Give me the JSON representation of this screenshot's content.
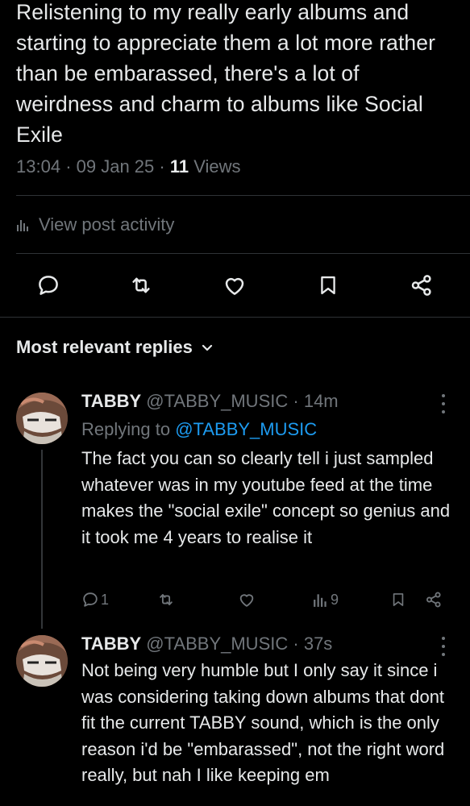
{
  "post": {
    "text": "Relistening to my really early albums and starting to appreciate them a lot more rather than be embarassed, there's a lot of weirdness and charm to albums like Social Exile",
    "time": "13:04",
    "date": "09 Jan 25",
    "views_count": "11",
    "views_label": "Views",
    "separator": "·"
  },
  "activity": {
    "label": "View post activity",
    "icon": "chart-bars-icon"
  },
  "actions": {
    "icons": [
      "reply-icon",
      "retweet-icon",
      "like-icon",
      "bookmark-icon",
      "share-icon"
    ]
  },
  "sort": {
    "label": "Most relevant replies"
  },
  "replies": [
    {
      "name": "TABBY",
      "handle": "@TABBY_MUSIC",
      "age": "14m",
      "replying_prefix": "Replying to",
      "replying_handle": "@TABBY_MUSIC",
      "text": "The fact you can so clearly tell i just sampled whatever was in my youtube feed at the time makes the \"social exile\" concept so genius and it took me 4 years to realise it",
      "reply_count": "1",
      "view_count": "9"
    },
    {
      "name": "TABBY",
      "handle": "@TABBY_MUSIC",
      "age": "37s",
      "text": "Not being very humble but I only say it since i was considering taking down albums that dont fit the current TABBY sound, which is the only reason i'd be \"embarassed\", not the right word really, but nah I like keeping em"
    }
  ],
  "colors": {
    "background": "#000000",
    "text": "#e7e9ea",
    "muted": "#71767b",
    "link": "#1d9bf0",
    "divider": "#2f3336"
  }
}
